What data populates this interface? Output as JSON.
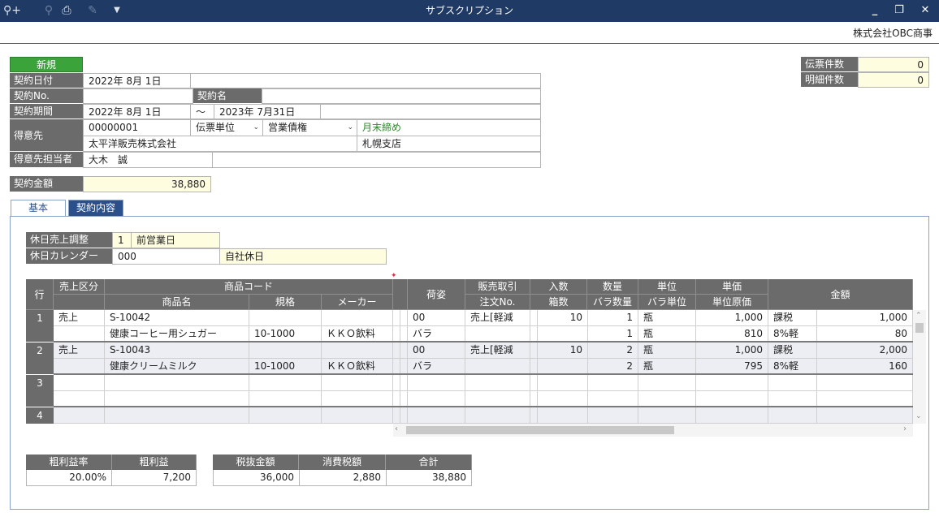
{
  "window": {
    "title": "サブスクリプション",
    "company": "株式会社OBC商事"
  },
  "header": {
    "status": "新規",
    "contract_date_label": "契約日付",
    "contract_date": "2022年  8月  1日",
    "contract_no_label": "契約No.",
    "contract_no": "",
    "contract_name_label": "契約名",
    "contract_name": "",
    "period_label": "契約期間",
    "period_start": "2022年  8月  1日",
    "period_tilde": "～",
    "period_end": "2023年  7月31日",
    "customer_label": "得意先",
    "customer_code": "00000001",
    "slip_unit": "伝票単位",
    "receivable": "営業債権",
    "closing": "月末締め",
    "customer_name": "太平洋販売株式会社",
    "branch": "札幌支店",
    "rep_label": "得意先担当者",
    "rep": "大木　誠",
    "amount_label": "契約金額",
    "amount": "38,880"
  },
  "counters": {
    "slip_count_label": "伝票件数",
    "slip_count": "0",
    "detail_count_label": "明細件数",
    "detail_count": "0"
  },
  "tabs": {
    "basic": "基本",
    "contract": "契約内容"
  },
  "holiday": {
    "adjust_label": "休日売上調整",
    "adjust_code": "1",
    "adjust_value": "前営業日",
    "calendar_label": "休日カレンダー",
    "calendar_code": "000",
    "calendar_value": "自社休日"
  },
  "grid": {
    "headers": {
      "row": "行",
      "sales_type": "売上区分",
      "product_code": "商品コード",
      "product_name": "商品名",
      "spec": "規格",
      "maker": "メーカー",
      "packing": "荷姿",
      "sales_deal": "販売取引",
      "order_no": "注文No.",
      "in_qty": "入数",
      "boxes": "箱数",
      "qty": "数量",
      "loose_qty": "バラ数量",
      "unit": "単位",
      "loose_unit": "バラ単位",
      "unit_price": "単価",
      "unit_cost": "単位原価",
      "amount": "金額"
    },
    "rows": [
      {
        "no": "1",
        "sales_type": "売上",
        "code": "S-10042",
        "name": "健康コーヒー用シュガー",
        "spec": "10-1000",
        "maker": "ＫＫＯ飲料",
        "packing": "00",
        "packing2": "バラ",
        "deal": "売上[軽減",
        "in_qty": "10",
        "qty": "1",
        "loose_qty": "1",
        "unit": "瓶",
        "loose_unit": "瓶",
        "price": "1,000",
        "cost": "810",
        "tax": "課税",
        "tax_rate": "8%軽",
        "amount": "1,000",
        "tax_amount": "80"
      },
      {
        "no": "2",
        "sales_type": "売上",
        "code": "S-10043",
        "name": "健康クリームミルク",
        "spec": "10-1000",
        "maker": "ＫＫＯ飲料",
        "packing": "00",
        "packing2": "バラ",
        "deal": "売上[軽減",
        "in_qty": "10",
        "qty": "2",
        "loose_qty": "2",
        "unit": "瓶",
        "loose_unit": "瓶",
        "price": "1,000",
        "cost": "795",
        "tax": "課税",
        "tax_rate": "8%軽",
        "amount": "2,000",
        "tax_amount": "160"
      },
      {
        "no": "3"
      },
      {
        "no": "4"
      }
    ]
  },
  "summary": {
    "margin_rate_label": "粗利益率",
    "margin_rate": "20.00%",
    "margin_label": "粗利益",
    "margin": "7,200",
    "excl_label": "税抜金額",
    "excl": "36,000",
    "tax_label": "消費税額",
    "tax": "2,880",
    "total_label": "合計",
    "total": "38,880"
  }
}
